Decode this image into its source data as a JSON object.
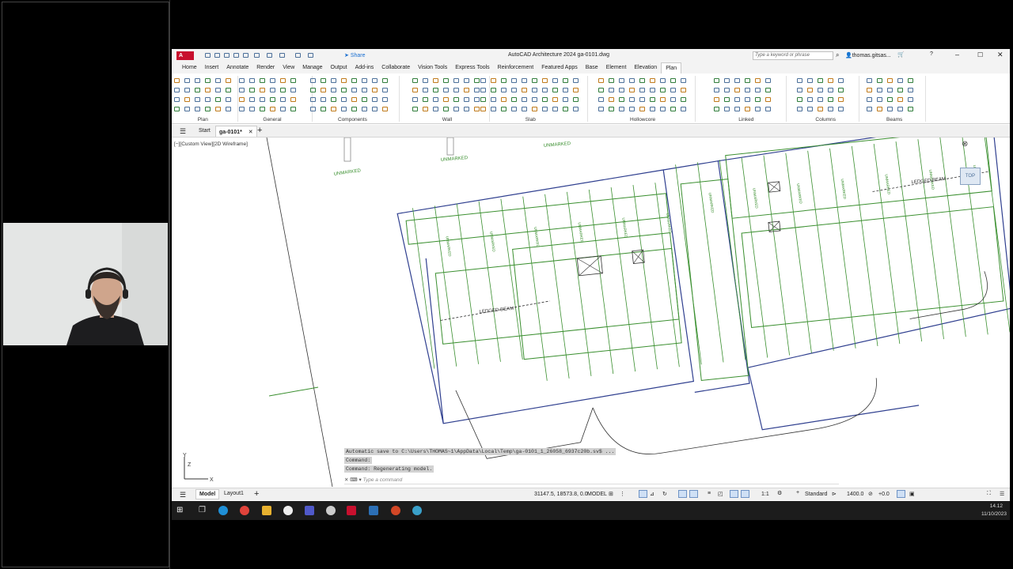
{
  "titlebar": {
    "app_title": "AutoCAD Architecture 2024   ga-0101.dwg",
    "share_label": "Share",
    "search_placeholder": "Type a keyword or phrase",
    "user_name": "thomas.gitsas..."
  },
  "ribbon_tabs": [
    "Home",
    "Insert",
    "Annotate",
    "Render",
    "View",
    "Manage",
    "Output",
    "Add-ins",
    "Collaborate",
    "Vision Tools",
    "Express Tools",
    "Reinforcement",
    "Featured Apps",
    "Base",
    "Element",
    "Elevation",
    "Plan"
  ],
  "active_tab": "Plan",
  "ribbon_panels": [
    "Plan",
    "General",
    "Components",
    "Wall",
    "Slab",
    "Hollowcore",
    "Linked",
    "Columns",
    "Beams"
  ],
  "doc_tabs": {
    "start_label": "Start",
    "active_doc": "ga-0101*"
  },
  "viewport": {
    "view_label": "[−][Custom View][2D Wireframe]",
    "viewcube_label": "TOP",
    "drawing_labels": {
      "unmarked": "UNMARKED",
      "ledged_beam": "LEDGED-BEAM"
    }
  },
  "command": {
    "history": [
      "Automatic save to C:\\Users\\THOMAS~1\\AppData\\Local\\Temp\\ga-0101_1_26058_6937c20b.sv$ ...",
      "Command:",
      "Command:  Regenerating model."
    ],
    "placeholder": "Type a command"
  },
  "layout_tabs": {
    "model": "Model",
    "layout1": "Layout1"
  },
  "statusbar": {
    "coords": "31147.5, 18573.8, 0.0",
    "space": "MODEL",
    "scale": "1:1",
    "style": "Standard",
    "elevation": "1400.0",
    "offset": "+0.0"
  },
  "taskbar": {
    "time": "14.12",
    "date": "11/10/2023"
  },
  "colors": {
    "drawing_green": "#3a8f2f",
    "drawing_blue": "#2f3f8f",
    "autocad_red": "#c8102e"
  }
}
